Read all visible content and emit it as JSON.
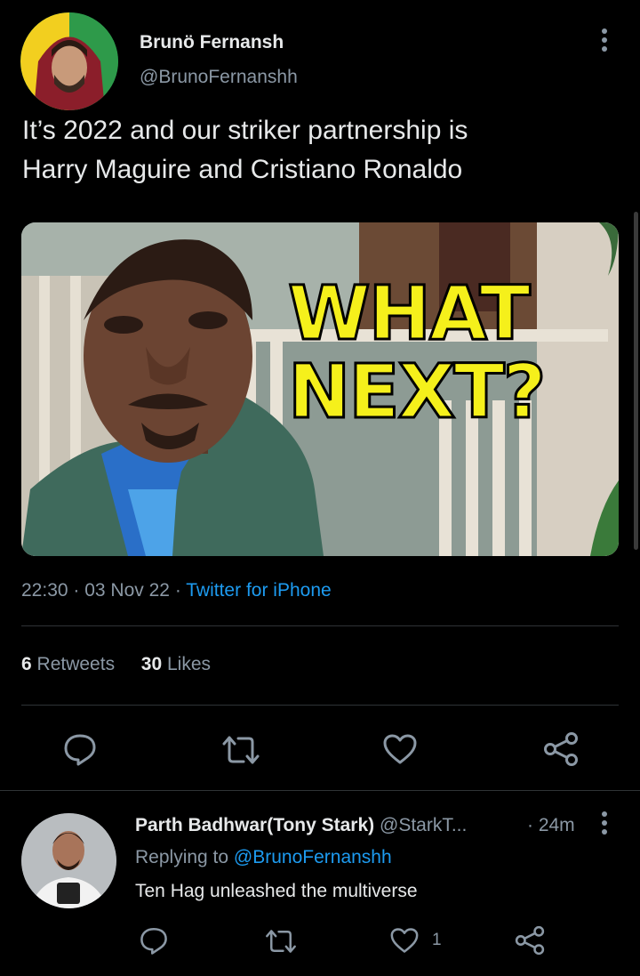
{
  "tweet": {
    "author_name": "Brunö Fernansh",
    "author_handle": "@BrunoFernanshh",
    "text_line1": "It’s 2022 and our striker partnership is",
    "text_line2": "Harry Maguire and Cristiano Ronaldo",
    "image_text_line1": "WHAT",
    "image_text_line2": "NEXT?",
    "time": "22:30",
    "date": "03 Nov 22",
    "source": "Twitter for iPhone",
    "retweets_count": "6",
    "retweets_label": "Retweets",
    "likes_count": "30",
    "likes_label": "Likes"
  },
  "reply": {
    "author_name": "Parth Badhwar(Tony Stark)",
    "author_handle": "@StarkT...",
    "time": "· 24m",
    "replying_prefix": "Replying to",
    "replying_handle": "@BrunoFernanshh",
    "text": "Ten Hag unleashed the multiverse",
    "like_count": "1"
  },
  "icons": {
    "more": "more-vertical-icon",
    "reply": "reply-bubble-icon",
    "retweet": "retweet-icon",
    "like": "heart-icon",
    "share": "share-icon"
  },
  "colors": {
    "background": "#000000",
    "text": "#e7e9ea",
    "muted": "#8b98a5",
    "link": "#1d9bf0",
    "image_text": "#f5f01b"
  }
}
